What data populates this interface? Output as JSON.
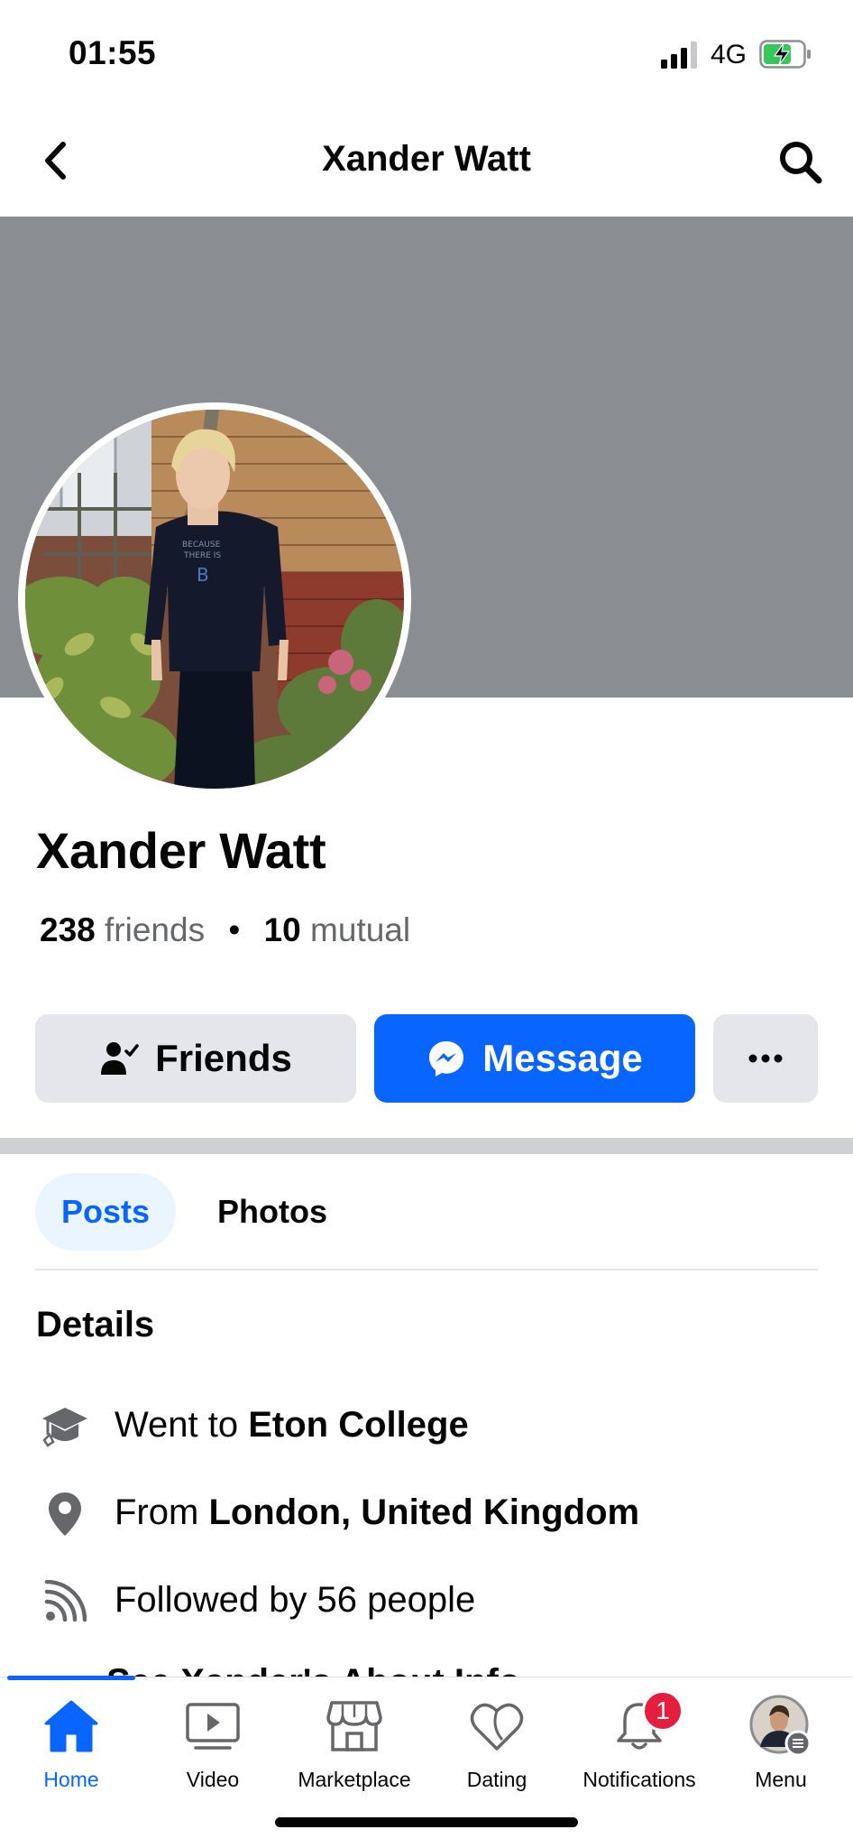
{
  "status_bar": {
    "time": "01:55",
    "network": "4G",
    "icons": [
      "signal-icon",
      "battery-charging-icon"
    ],
    "battery_color": "#34c759"
  },
  "header": {
    "title": "Xander Watt",
    "back_icon": "chevron-left-icon",
    "search_icon": "search-icon"
  },
  "profile": {
    "name": "Xander Watt",
    "friends_count": "238",
    "friends_label": "friends",
    "separator": "•",
    "mutual_count": "10",
    "mutual_label": "mutual",
    "cover_color": "#8a8d91"
  },
  "actions": {
    "friends_label": "Friends",
    "message_label": "Message",
    "more_label": "•••"
  },
  "tabs": [
    {
      "label": "Posts",
      "active": true
    },
    {
      "label": "Photos",
      "active": false
    }
  ],
  "details": {
    "title": "Details",
    "rows": [
      {
        "icon": "graduation-cap-icon",
        "prefix": "Went to ",
        "bold": "Eton College"
      },
      {
        "icon": "location-pin-icon",
        "prefix": "From ",
        "bold": "London, United Kingdom"
      },
      {
        "icon": "rss-feed-icon",
        "prefix": "Followed by 56 people",
        "bold": ""
      }
    ],
    "cutoff_text": "See Xander's About Info"
  },
  "tabbar": {
    "items": [
      {
        "label": "Home",
        "icon": "home-icon",
        "active": true
      },
      {
        "label": "Video",
        "icon": "video-icon",
        "active": false
      },
      {
        "label": "Marketplace",
        "icon": "marketplace-icon",
        "active": false
      },
      {
        "label": "Dating",
        "icon": "dating-heart-icon",
        "active": false
      },
      {
        "label": "Notifications",
        "icon": "bell-icon",
        "active": false
      },
      {
        "label": "Menu",
        "icon": "menu-avatar-icon",
        "active": false
      }
    ],
    "notifications_badge": "1"
  },
  "colors": {
    "accent": "#0866ff",
    "button_gray": "#e4e6eb",
    "badge_red": "#e41e3f"
  }
}
